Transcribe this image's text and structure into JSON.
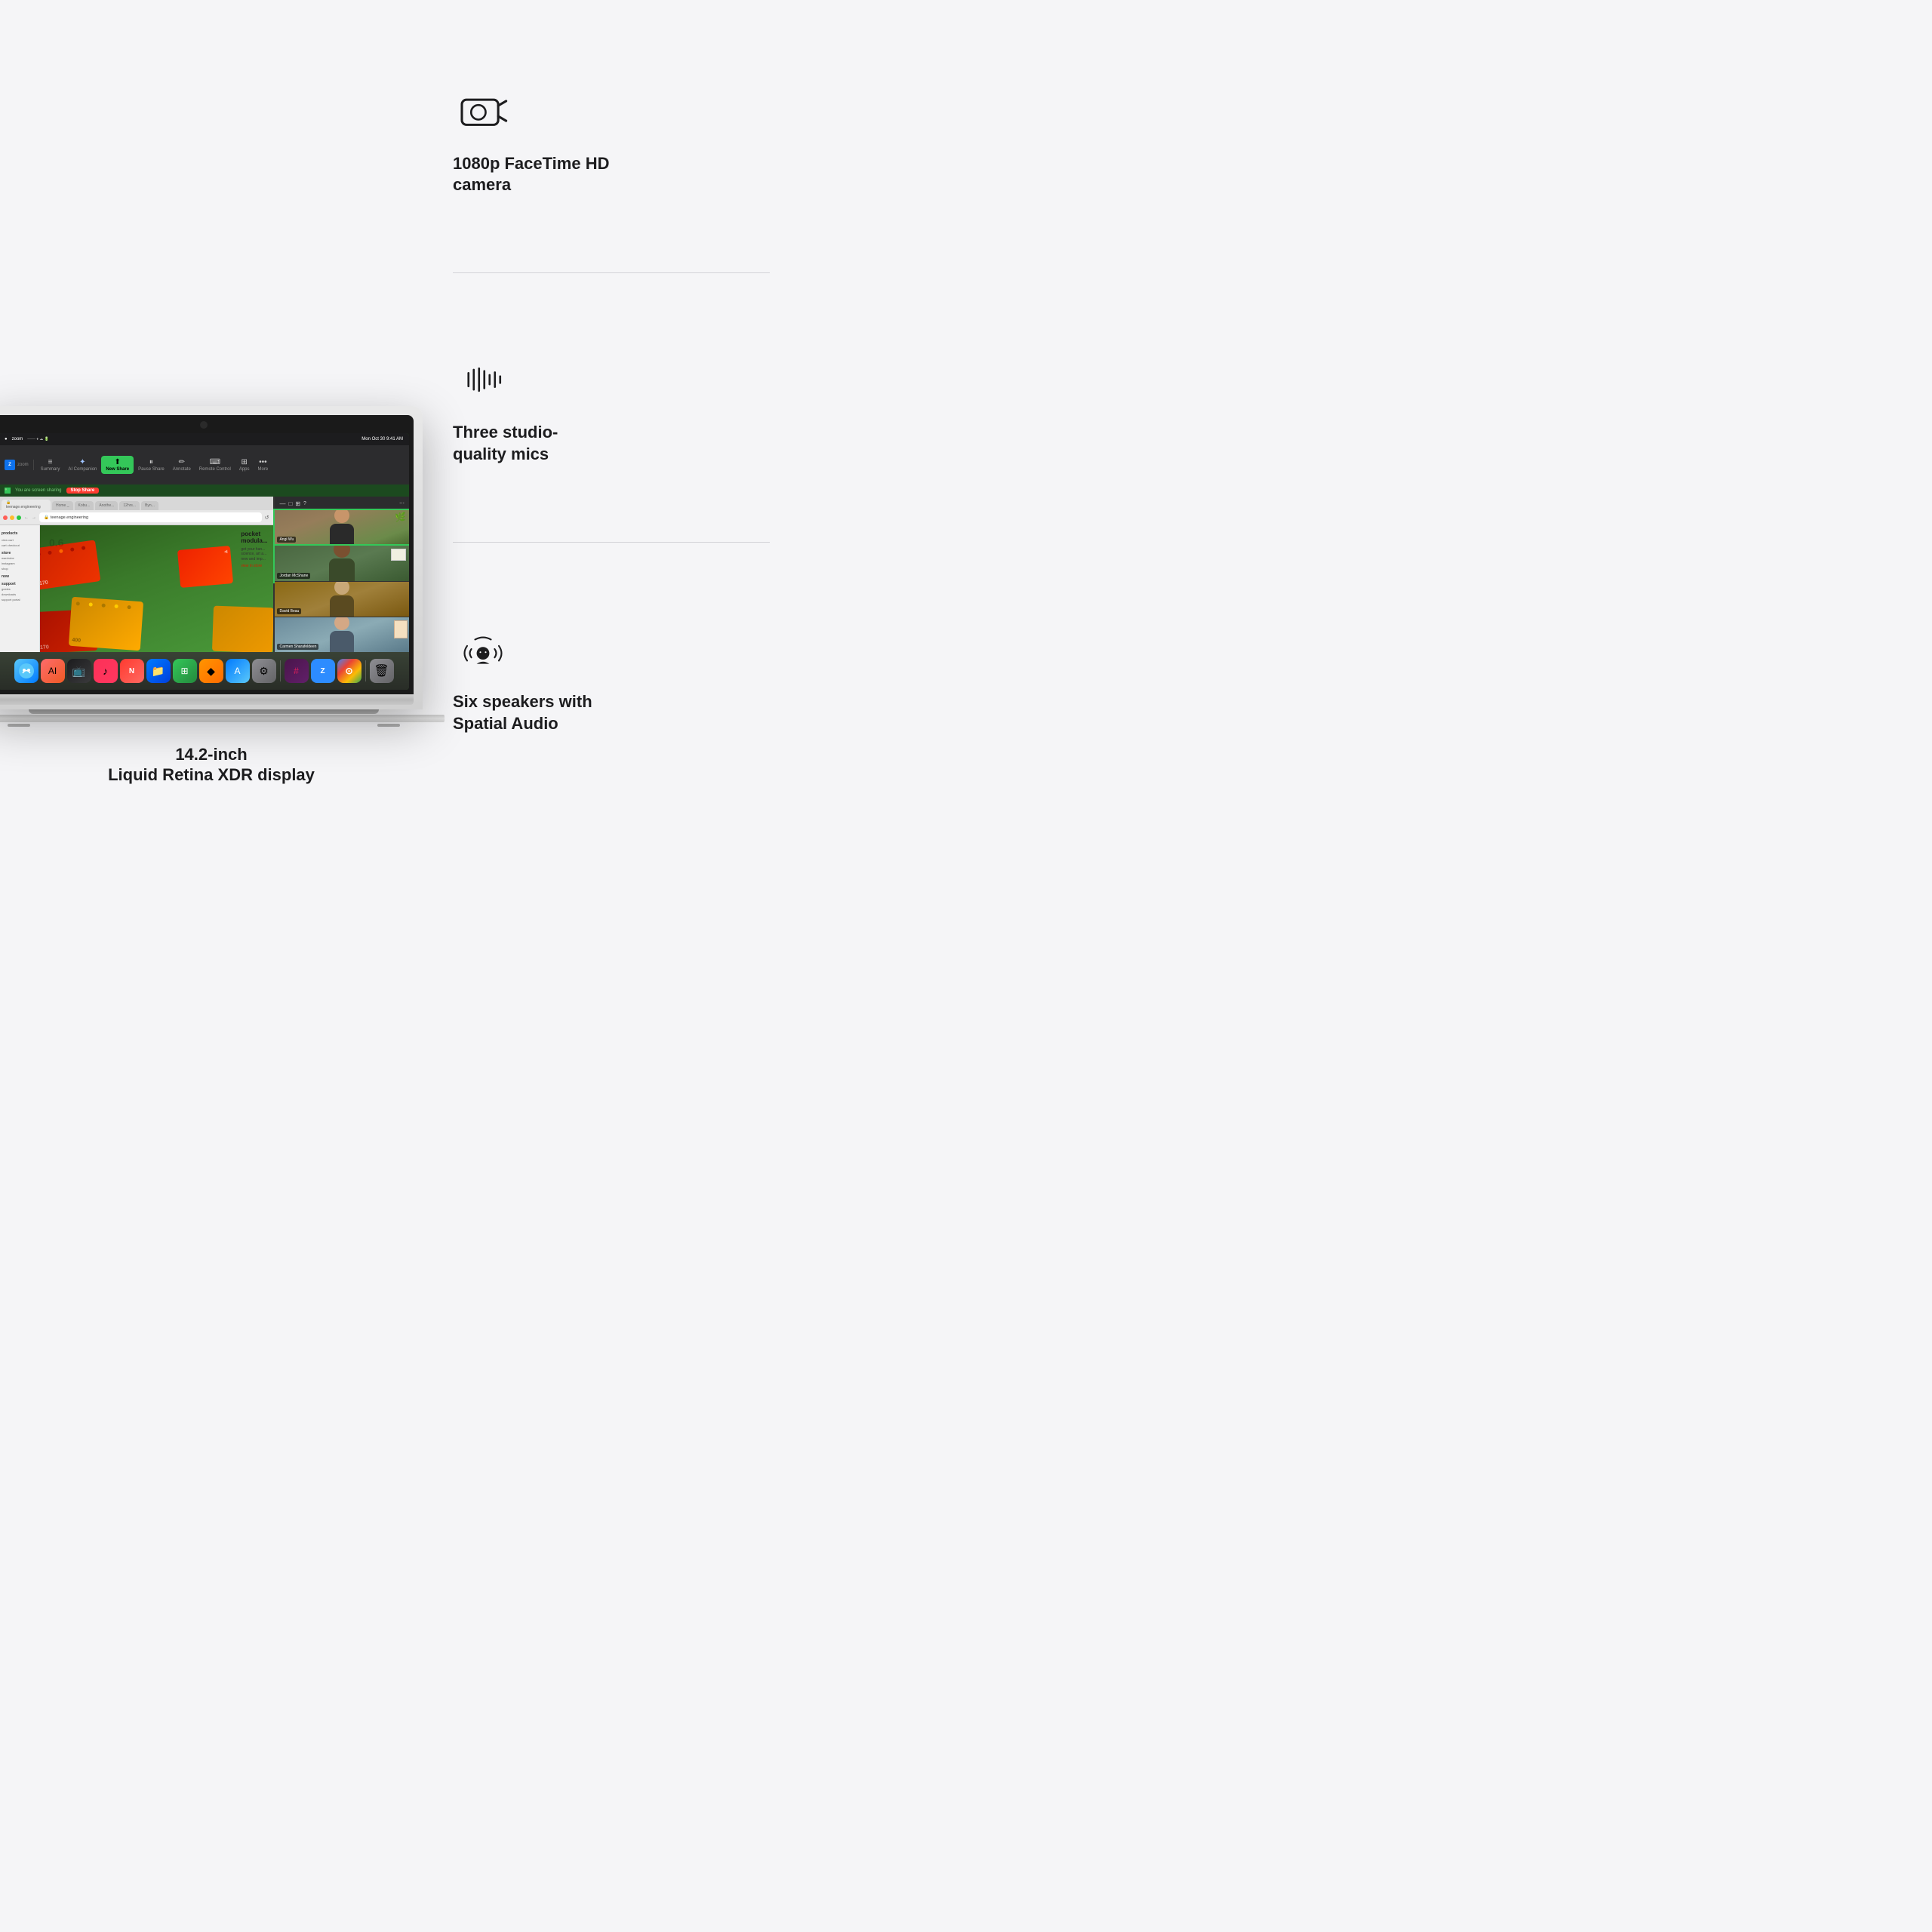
{
  "page": {
    "background_color": "#f5f5f7"
  },
  "left": {
    "caption_line1": "14.2-inch",
    "caption_line2": "Liquid Retina XDR display"
  },
  "right": {
    "features": [
      {
        "id": "camera",
        "icon_name": "camera-icon",
        "text_line1": "1080p FaceTime HD",
        "text_line2": "camera"
      },
      {
        "id": "mic",
        "icon_name": "microphone-icon",
        "text_line1": "Three studio-",
        "text_line2": "quality mics"
      },
      {
        "id": "speaker",
        "icon_name": "speaker-icon",
        "text_line1": "Six speakers with",
        "text_line2": "Spatial Audio"
      }
    ]
  },
  "macbook": {
    "screen": {
      "zoom": {
        "toolbar_items": [
          {
            "label": "Summary",
            "icon": "≡"
          },
          {
            "label": "AI Companion",
            "icon": "✦"
          },
          {
            "label": "New Share",
            "icon": "⬆",
            "highlighted": true
          },
          {
            "label": "Pause Share",
            "icon": "⏸"
          },
          {
            "label": "Annotate",
            "icon": "✏"
          },
          {
            "label": "Remote Control",
            "icon": "🖱"
          },
          {
            "label": "Apps",
            "icon": "⊞"
          },
          {
            "label": "More",
            "icon": "•••"
          }
        ],
        "status_bar": "You are screen sharing",
        "stop_share": "Stop Share",
        "time": "Mon Oct 30  9:41 AM"
      },
      "safari": {
        "url": "teenage.engineering",
        "tabs": [
          "Home _",
          "Kobu...",
          "Anothe...",
          "12hrs...",
          "Byn..."
        ]
      },
      "participants": [
        {
          "name": "Angi Wu",
          "active": true
        },
        {
          "name": "Jordan McShane",
          "active": true
        },
        {
          "name": "David Beau",
          "active": false
        },
        {
          "name": "Carmen Sharafeldeen",
          "active": false
        }
      ],
      "website": {
        "nav_items": [
          "products",
          "store",
          "now",
          "support"
        ],
        "hero_text_1": "pocket",
        "hero_text_2": "modula..."
      }
    }
  },
  "dock_apps": [
    "Finder",
    "AI",
    "TV",
    "Music",
    "News",
    "Files",
    "Numbers",
    "Keynote",
    "App Store",
    "Settings",
    "Slack",
    "Zoom",
    "Chrome",
    "Trash"
  ]
}
